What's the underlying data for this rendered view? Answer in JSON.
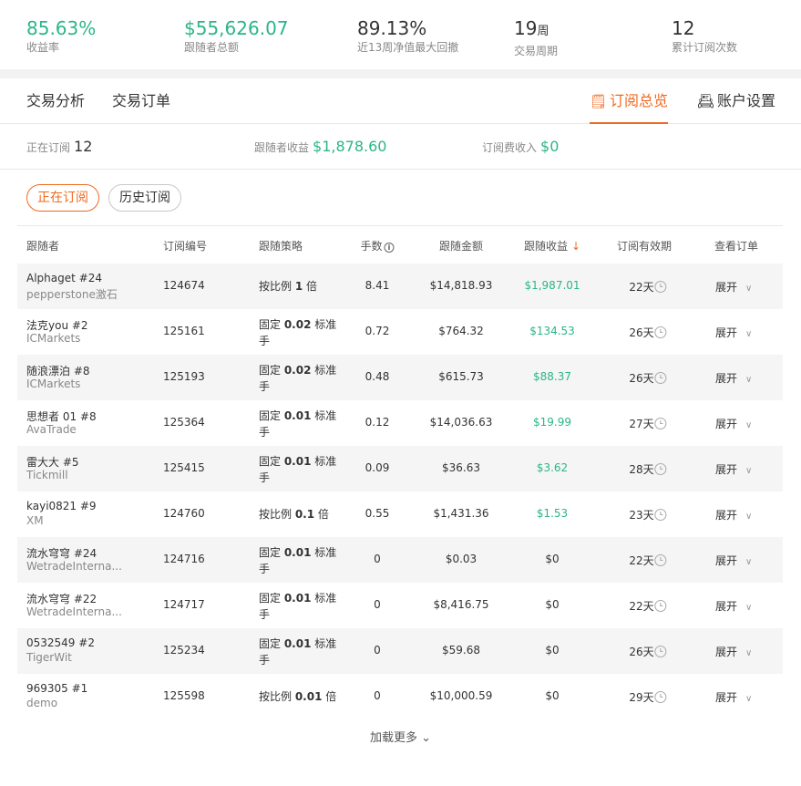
{
  "stats": [
    {
      "value": "85.63%",
      "unit": "",
      "label": "收益率",
      "green": true
    },
    {
      "value": "$55,626.07",
      "unit": "",
      "label": "跟随者总额",
      "green": true
    },
    {
      "value": "89.13%",
      "unit": "",
      "label": "近13周净值最大回撤",
      "green": false
    },
    {
      "value": "19",
      "unit": "周",
      "label": "交易周期",
      "green": false
    },
    {
      "value": "12",
      "unit": "",
      "label": "累计订阅次数",
      "green": false
    }
  ],
  "tabs": {
    "analysis": "交易分析",
    "orders": "交易订单",
    "subscription": "订阅总览",
    "settings": "账户设置"
  },
  "summary": {
    "active_label": "正在订阅",
    "active_value": "12",
    "profit_label": "跟随者收益",
    "profit_value": "$1,878.60",
    "fee_label": "订阅费收入",
    "fee_value": "$0"
  },
  "filters": {
    "active": "正在订阅",
    "history": "历史订阅"
  },
  "columns": {
    "follower": "跟随者",
    "sub_id": "订阅编号",
    "strategy": "跟随策略",
    "lots": "手数",
    "amount": "跟随金额",
    "profit": "跟随收益",
    "validity": "订阅有效期",
    "view": "查看订单"
  },
  "rows": [
    {
      "name": "Alphaget #24",
      "broker": "pepperstone激石",
      "id": "124674",
      "s_pre": "按比例 ",
      "s_val": "1",
      "s_post": " 倍",
      "lots": "8.41",
      "amount": "$14,818.93",
      "profit": "$1,987.01",
      "profit_green": true,
      "days": "22天",
      "expand": "展开"
    },
    {
      "name": "法克you #2",
      "broker": "ICMarkets",
      "id": "125161",
      "s_pre": "固定 ",
      "s_val": "0.02",
      "s_post": " 标准手",
      "lots": "0.72",
      "amount": "$764.32",
      "profit": "$134.53",
      "profit_green": true,
      "days": "26天",
      "expand": "展开"
    },
    {
      "name": "随浪漂泊 #8",
      "broker": "ICMarkets",
      "id": "125193",
      "s_pre": "固定 ",
      "s_val": "0.02",
      "s_post": " 标准手",
      "lots": "0.48",
      "amount": "$615.73",
      "profit": "$88.37",
      "profit_green": true,
      "days": "26天",
      "expand": "展开"
    },
    {
      "name": "思想者 01 #8",
      "broker": "AvaTrade",
      "id": "125364",
      "s_pre": "固定 ",
      "s_val": "0.01",
      "s_post": " 标准手",
      "lots": "0.12",
      "amount": "$14,036.63",
      "profit": "$19.99",
      "profit_green": true,
      "days": "27天",
      "expand": "展开"
    },
    {
      "name": "雷大大 #5",
      "broker": "Tickmill",
      "id": "125415",
      "s_pre": "固定 ",
      "s_val": "0.01",
      "s_post": " 标准手",
      "lots": "0.09",
      "amount": "$36.63",
      "profit": "$3.62",
      "profit_green": true,
      "days": "28天",
      "expand": "展开"
    },
    {
      "name": "kayi0821 #9",
      "broker": "XM",
      "id": "124760",
      "s_pre": "按比例 ",
      "s_val": "0.1",
      "s_post": " 倍",
      "lots": "0.55",
      "amount": "$1,431.36",
      "profit": "$1.53",
      "profit_green": true,
      "days": "23天",
      "expand": "展开"
    },
    {
      "name": "流水穹穹 #24",
      "broker": "WetradeInterna...",
      "id": "124716",
      "s_pre": "固定 ",
      "s_val": "0.01",
      "s_post": " 标准手",
      "lots": "0",
      "amount": "$0.03",
      "profit": "$0",
      "profit_green": false,
      "days": "22天",
      "expand": "展开"
    },
    {
      "name": "流水穹穹 #22",
      "broker": "WetradeInterna...",
      "id": "124717",
      "s_pre": "固定 ",
      "s_val": "0.01",
      "s_post": " 标准手",
      "lots": "0",
      "amount": "$8,416.75",
      "profit": "$0",
      "profit_green": false,
      "days": "22天",
      "expand": "展开"
    },
    {
      "name": "0532549 #2",
      "broker": "TigerWit",
      "id": "125234",
      "s_pre": "固定 ",
      "s_val": "0.01",
      "s_post": " 标准手",
      "lots": "0",
      "amount": "$59.68",
      "profit": "$0",
      "profit_green": false,
      "days": "26天",
      "expand": "展开"
    },
    {
      "name": "969305 #1",
      "broker": "demo",
      "id": "125598",
      "s_pre": "按比例 ",
      "s_val": "0.01",
      "s_post": " 倍",
      "lots": "0",
      "amount": "$10,000.59",
      "profit": "$0",
      "profit_green": false,
      "days": "29天",
      "expand": "展开"
    }
  ],
  "load_more": "加载更多"
}
